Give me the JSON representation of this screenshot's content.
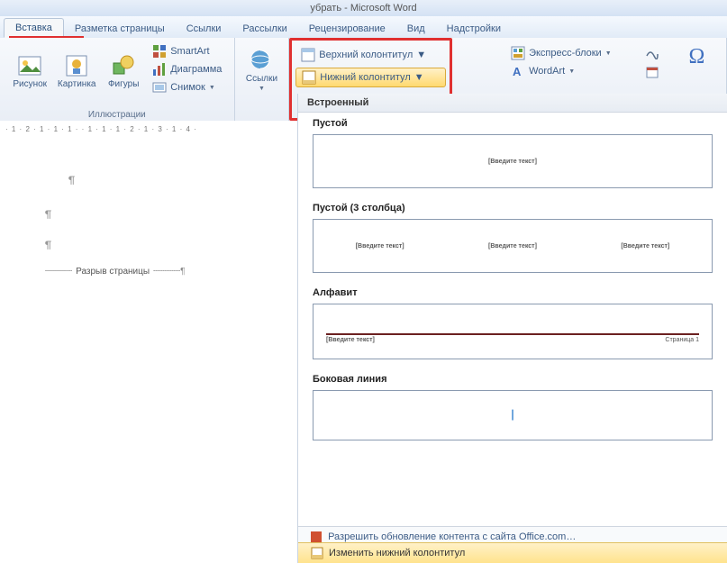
{
  "window": {
    "title": "убрать - Microsoft Word"
  },
  "tabs": {
    "insert": "Вставка",
    "pagelayout": "Разметка страницы",
    "references": "Ссылки",
    "mailings": "Рассылки",
    "review": "Рецензирование",
    "view": "Вид",
    "addins": "Надстройки"
  },
  "ribbon": {
    "illustrations": {
      "label": "Иллюстрации",
      "picture": "Рисунок",
      "clipart": "Картинка",
      "shapes": "Фигуры",
      "smartart": "SmartArt",
      "chart": "Диаграмма",
      "screenshot": "Снимок"
    },
    "links": {
      "label": "Ссылки",
      "links_btn": "Ссылки"
    },
    "headerfooter": {
      "header": "Верхний колонтитул",
      "footer": "Нижний колонтитул"
    },
    "text": {
      "quickparts": "Экспресс-блоки",
      "wordart": "WordArt"
    },
    "symbols": {
      "label": "Символы"
    }
  },
  "ruler": "· 1 · 2 · 1 · 1 · 1 ·  · 1 · 1 · 1 · 2 · 1 · 3 · 1 · 4 ·",
  "doc": {
    "pagebreak": "Разрыв страницы"
  },
  "gallery": {
    "builtin": "Встроенный",
    "items": {
      "blank": {
        "title": "Пустой",
        "placeholder": "[Введите текст]"
      },
      "blank3": {
        "title": "Пустой (3 столбца)",
        "placeholder": "[Введите текст]"
      },
      "alphabet": {
        "title": "Алфавит",
        "placeholder": "[Введите текст]",
        "page": "Страница 1"
      },
      "sideline": {
        "title": "Боковая линия"
      }
    },
    "update": "Разрешить обновление контента с сайта Office.com…",
    "edit": "Изменить нижний колонтитул"
  }
}
